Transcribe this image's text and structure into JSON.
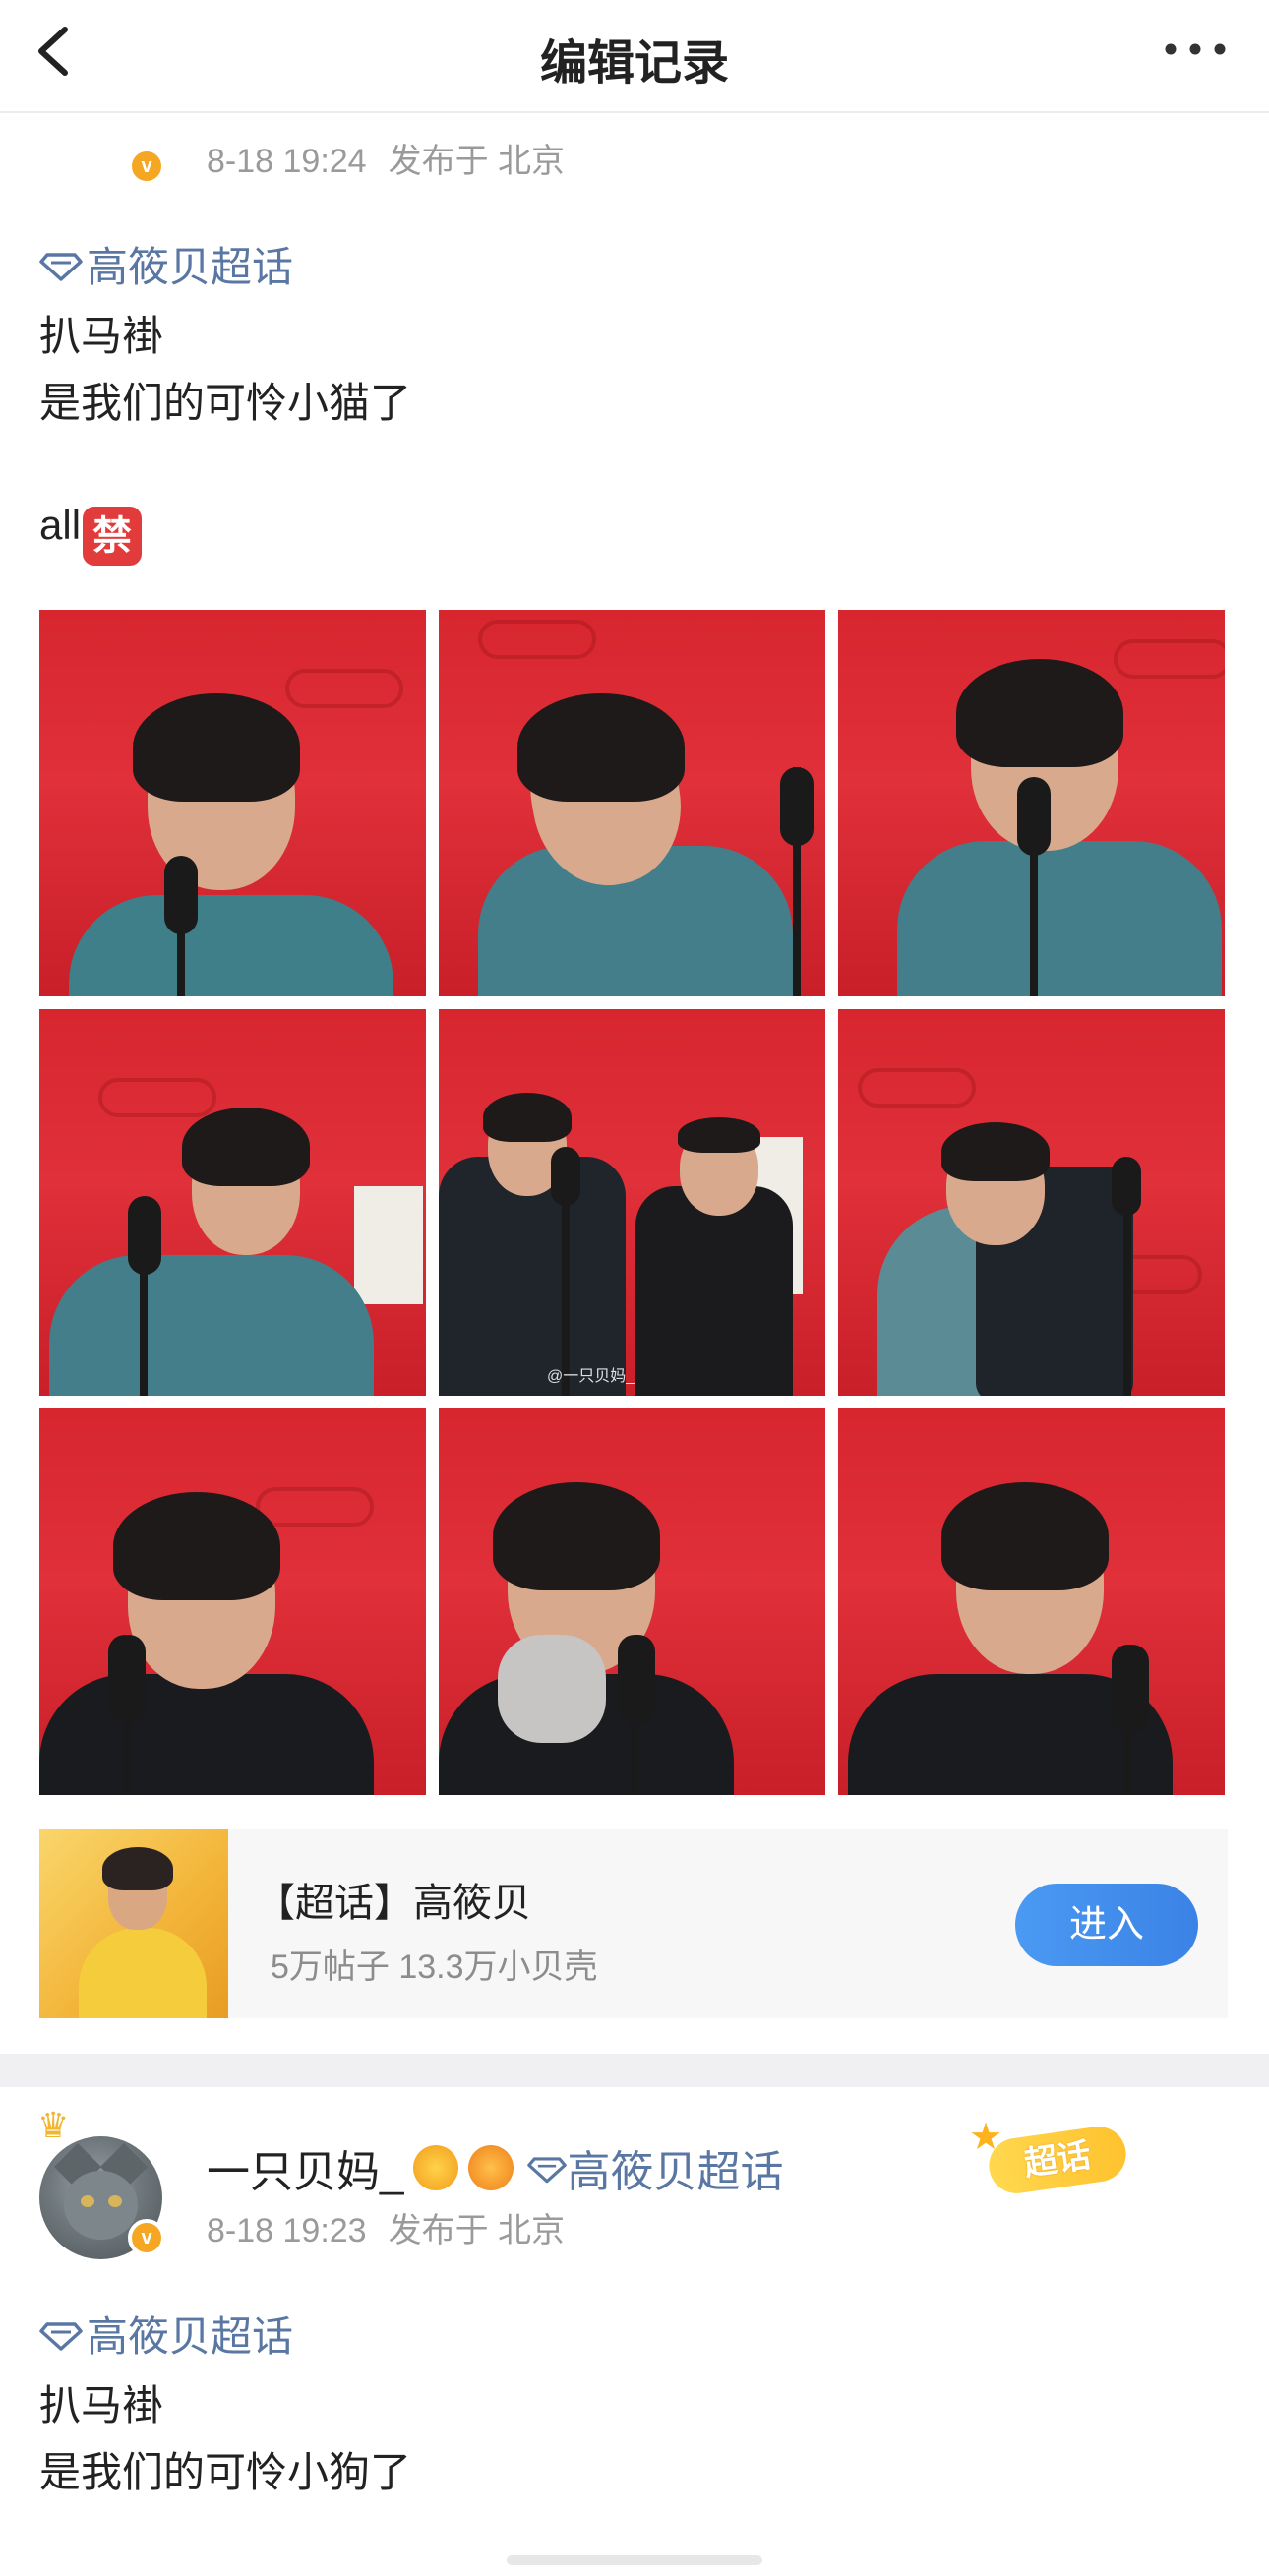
{
  "nav": {
    "title": "编辑记录"
  },
  "post1": {
    "meta_time": "8-18 19:24",
    "meta_loc": "发布于 北京",
    "topic": "高筱贝超话",
    "lines": [
      "扒马褂",
      "是我们的可怜小猫了",
      "all"
    ],
    "ban_emoji": "禁",
    "watermark": "@一只贝妈_",
    "supertopic_card": {
      "title": "【超话】高筱贝",
      "subtitle": "5万帖子 13.3万小贝壳",
      "button": "进入"
    }
  },
  "post2": {
    "username": "一只贝妈_",
    "user_topic": "高筱贝超话",
    "tag": "超话",
    "meta_time": "8-18 19:23",
    "meta_loc": "发布于 北京",
    "topic": "高筱贝超话",
    "lines": [
      "扒马褂",
      "是我们的可怜小狗了"
    ]
  },
  "colors": {
    "accent_blue": "#3b82e6",
    "topic_blue": "#5a77a3",
    "stage_red": "#d7262e"
  },
  "icons": [
    "back-chevron-icon",
    "more-dots-icon",
    "topic-diamond-icon",
    "verified-v-icon"
  ]
}
